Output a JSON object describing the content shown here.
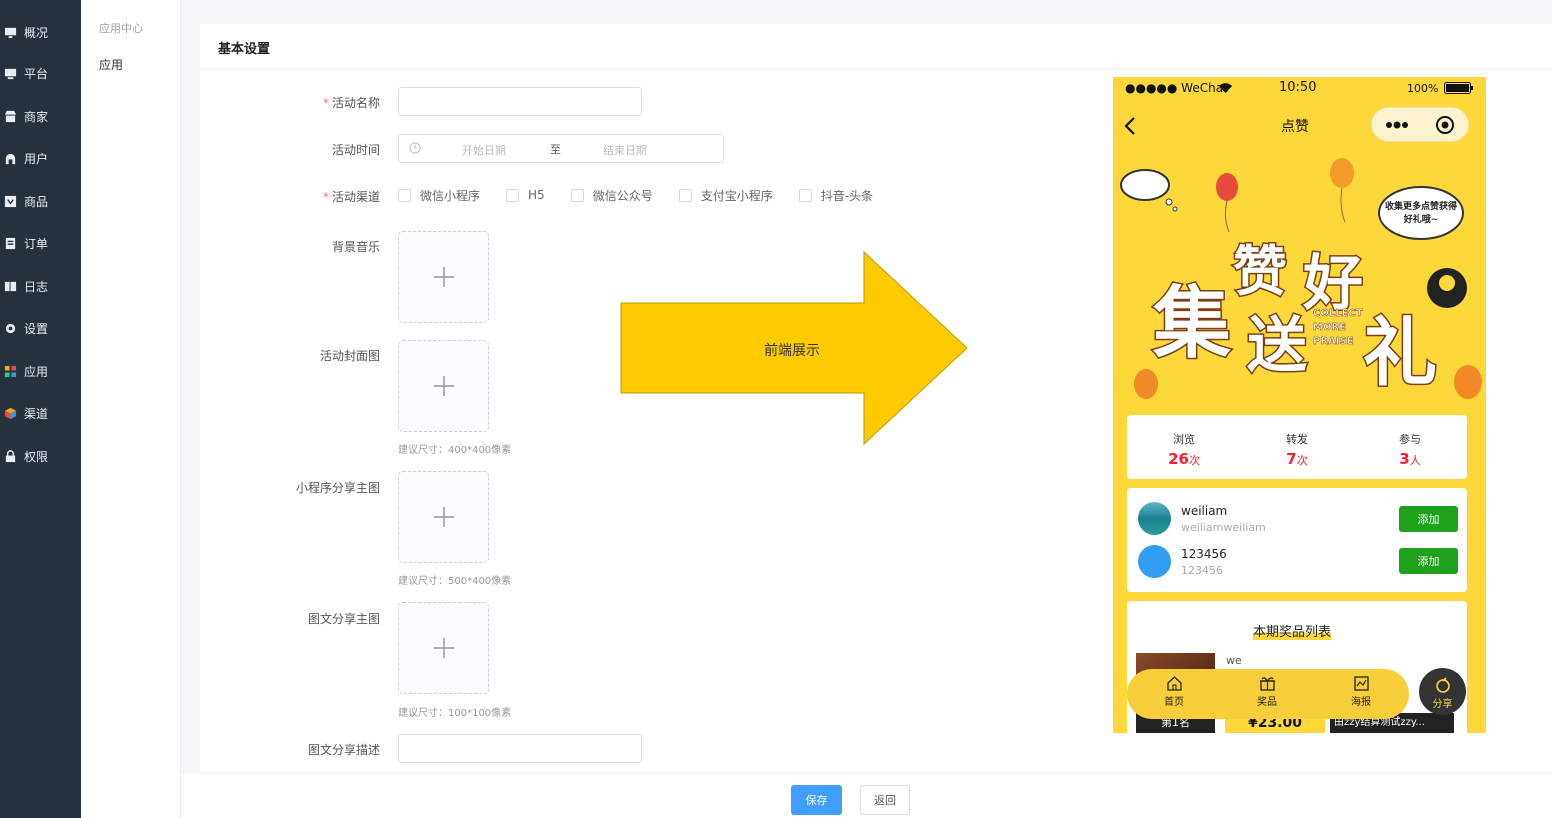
{
  "sidebar": {
    "items": [
      {
        "label": "概况",
        "icon": "dashboard-icon"
      },
      {
        "label": "平台",
        "icon": "monitor-icon"
      },
      {
        "label": "商家",
        "icon": "store-icon"
      },
      {
        "label": "用户",
        "icon": "user-icon"
      },
      {
        "label": "商品",
        "icon": "goods-icon"
      },
      {
        "label": "订单",
        "icon": "order-icon"
      },
      {
        "label": "日志",
        "icon": "log-icon"
      },
      {
        "label": "设置",
        "icon": "gear-icon"
      },
      {
        "label": "应用",
        "icon": "apps-icon"
      },
      {
        "label": "渠道",
        "icon": "channel-icon"
      },
      {
        "label": "权限",
        "icon": "lock-icon"
      }
    ]
  },
  "subnav": {
    "title": "应用中心",
    "item": "应用"
  },
  "form": {
    "card_title": "基本设置",
    "name_label": "活动名称",
    "time_label": "活动时间",
    "start_placeholder": "开始日期",
    "range_sep": "至",
    "end_placeholder": "结束日期",
    "channel_label": "活动渠道",
    "channels": [
      "微信小程序",
      "H5",
      "微信公众号",
      "支付宝小程序",
      "抖音-头条"
    ],
    "music_label": "背景音乐",
    "cover_label": "活动封面图",
    "cover_hint": "建议尺寸：400*400像素",
    "mini_share_label": "小程序分享主图",
    "mini_share_hint": "建议尺寸：500*400像素",
    "graphic_share_label": "图文分享主图",
    "graphic_share_hint": "建议尺寸：100*100像素",
    "graphic_desc_label": "图文分享描述",
    "required_mark": "*"
  },
  "footer": {
    "save": "保存",
    "back": "返回"
  },
  "arrow": {
    "label": "前端展示",
    "color": "#fecb00"
  },
  "phone": {
    "signal": "●●●●● WeChat",
    "time": "10:50",
    "battery": "100%",
    "title": "点赞",
    "banner": {
      "line1": "集赞好",
      "line2": "送礼",
      "char_zan": "赞",
      "char_hao": "好",
      "char_ji": "集",
      "char_song": "送",
      "char_li": "礼",
      "bubble": "收集更多点赞获得好礼哦~",
      "english": "COLLECT MORE PRAISE AND GET GOOD GIFTS"
    },
    "stats": [
      {
        "label": "浏览",
        "value": "26",
        "unit": "次"
      },
      {
        "label": "转发",
        "value": "7",
        "unit": "次"
      },
      {
        "label": "参与",
        "value": "3",
        "unit": "人"
      }
    ],
    "users": [
      {
        "name": "weiliam",
        "sub": "weiliamweiliam",
        "button": "添加"
      },
      {
        "name": "123456",
        "sub": "123456",
        "button": "添加"
      }
    ],
    "prize_title": "本期奖品列表",
    "prize_name": "we",
    "prize_rank": "第1名",
    "prize_price": "¥23.00",
    "prize_desc": "由zzy结算测试zzy...",
    "tabs": [
      "首页",
      "奖品",
      "海报"
    ],
    "share": "分享",
    "accent": "#fdd83a",
    "price_color": "#f5222d",
    "add_color": "#1fa21b"
  }
}
